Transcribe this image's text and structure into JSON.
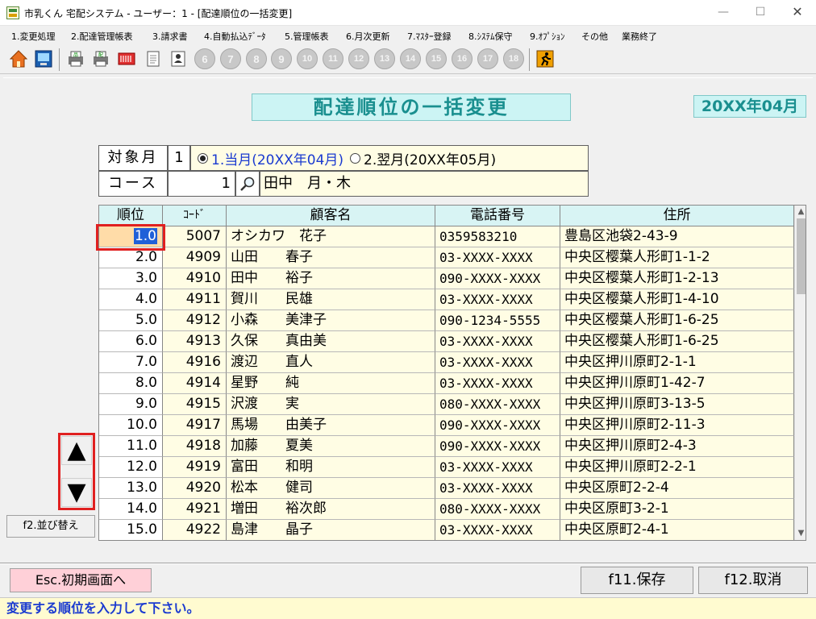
{
  "window": {
    "title": "市乳くん 宅配システム - ユーザー：1 - [配達順位の一括変更]",
    "minimize": "—",
    "maximize": "☐",
    "close": "✕"
  },
  "menu": [
    "1.変更処理",
    "2.配達管理帳表",
    "3.請求書",
    "4.自動払込ﾃﾞｰﾀ",
    "5.管理帳表",
    "6.月次更新",
    "7.ﾏｽﾀｰ登録",
    "8.ｼｽﾃﾑ保守",
    "9.ｵﾌﾟｼｮﾝ",
    "その他",
    "業務終了"
  ],
  "toolbar": {
    "numbered": [
      "6",
      "7",
      "8",
      "9",
      "10",
      "11",
      "12",
      "13",
      "14",
      "15",
      "16",
      "17",
      "18"
    ],
    "icons": [
      "home-icon",
      "monitor-icon",
      "print-product-icon",
      "print-delivery-icon",
      "barcode-icon",
      "document-icon",
      "person-card-icon",
      "exit-runner-icon"
    ]
  },
  "heading": "配達順位の一括変更",
  "period_badge": "20XX年04月",
  "form": {
    "month_label": "対象月",
    "month_value": "1",
    "option1": "1.当月(20XX年04月)",
    "option2": "2.翌月(20XX年05月)",
    "course_label": "コース",
    "course_value": "1",
    "course_name": "田中　月・木"
  },
  "table": {
    "headers": [
      "順位",
      "ｺｰﾄﾞ",
      "顧客名",
      "電話番号",
      "住所"
    ],
    "rows": [
      {
        "rank": "1.0",
        "code": "5007",
        "name": "オシカワ　花子",
        "phone": "0359583210",
        "address": "豊島区池袋2-43-9"
      },
      {
        "rank": "2.0",
        "code": "4909",
        "name": "山田　　春子",
        "phone": "03-XXXX-XXXX",
        "address": "中央区樱葉人形町1-1-2"
      },
      {
        "rank": "3.0",
        "code": "4910",
        "name": "田中　　裕子",
        "phone": "090-XXXX-XXXX",
        "address": "中央区樱葉人形町1-2-13"
      },
      {
        "rank": "4.0",
        "code": "4911",
        "name": "賀川　　民雄",
        "phone": "03-XXXX-XXXX",
        "address": "中央区樱葉人形町1-4-10"
      },
      {
        "rank": "5.0",
        "code": "4912",
        "name": "小森　　美津子",
        "phone": "090-1234-5555",
        "address": "中央区樱葉人形町1-6-25"
      },
      {
        "rank": "6.0",
        "code": "4913",
        "name": "久保　　真由美",
        "phone": "03-XXXX-XXXX",
        "address": "中央区樱葉人形町1-6-25"
      },
      {
        "rank": "7.0",
        "code": "4916",
        "name": "渡辺　　直人",
        "phone": "03-XXXX-XXXX",
        "address": "中央区押川原町2-1-1"
      },
      {
        "rank": "8.0",
        "code": "4914",
        "name": "星野　　純",
        "phone": "03-XXXX-XXXX",
        "address": "中央区押川原町1-42-7"
      },
      {
        "rank": "9.0",
        "code": "4915",
        "name": "沢渡　　実",
        "phone": "080-XXXX-XXXX",
        "address": "中央区押川原町3-13-5"
      },
      {
        "rank": "10.0",
        "code": "4917",
        "name": "馬場　　由美子",
        "phone": "090-XXXX-XXXX",
        "address": "中央区押川原町2-11-3"
      },
      {
        "rank": "11.0",
        "code": "4918",
        "name": "加藤　　夏美",
        "phone": "090-XXXX-XXXX",
        "address": "中央区押川原町2-4-3"
      },
      {
        "rank": "12.0",
        "code": "4919",
        "name": "富田　　和明",
        "phone": "03-XXXX-XXXX",
        "address": "中央区押川原町2-2-1"
      },
      {
        "rank": "13.0",
        "code": "4920",
        "name": "松本　　健司",
        "phone": "03-XXXX-XXXX",
        "address": "中央区原町2-2-4"
      },
      {
        "rank": "14.0",
        "code": "4921",
        "name": "増田　　裕次郎",
        "phone": "080-XXXX-XXXX",
        "address": "中央区原町3-2-1"
      },
      {
        "rank": "15.0",
        "code": "4922",
        "name": "島津　　晶子",
        "phone": "03-XXXX-XXXX",
        "address": "中央区原町2-4-1"
      }
    ]
  },
  "buttons": {
    "up": "▲",
    "down": "▼",
    "sort": "f2.並び替え",
    "esc": "Esc.初期画面へ",
    "save": "f11.保存",
    "cancel": "f12.取消"
  },
  "status": "変更する順位を入力して下さい。",
  "colors": {
    "accent_teal": "#1a8f8f",
    "highlight_red": "#e02020",
    "status_blue": "#1a3ad0"
  }
}
